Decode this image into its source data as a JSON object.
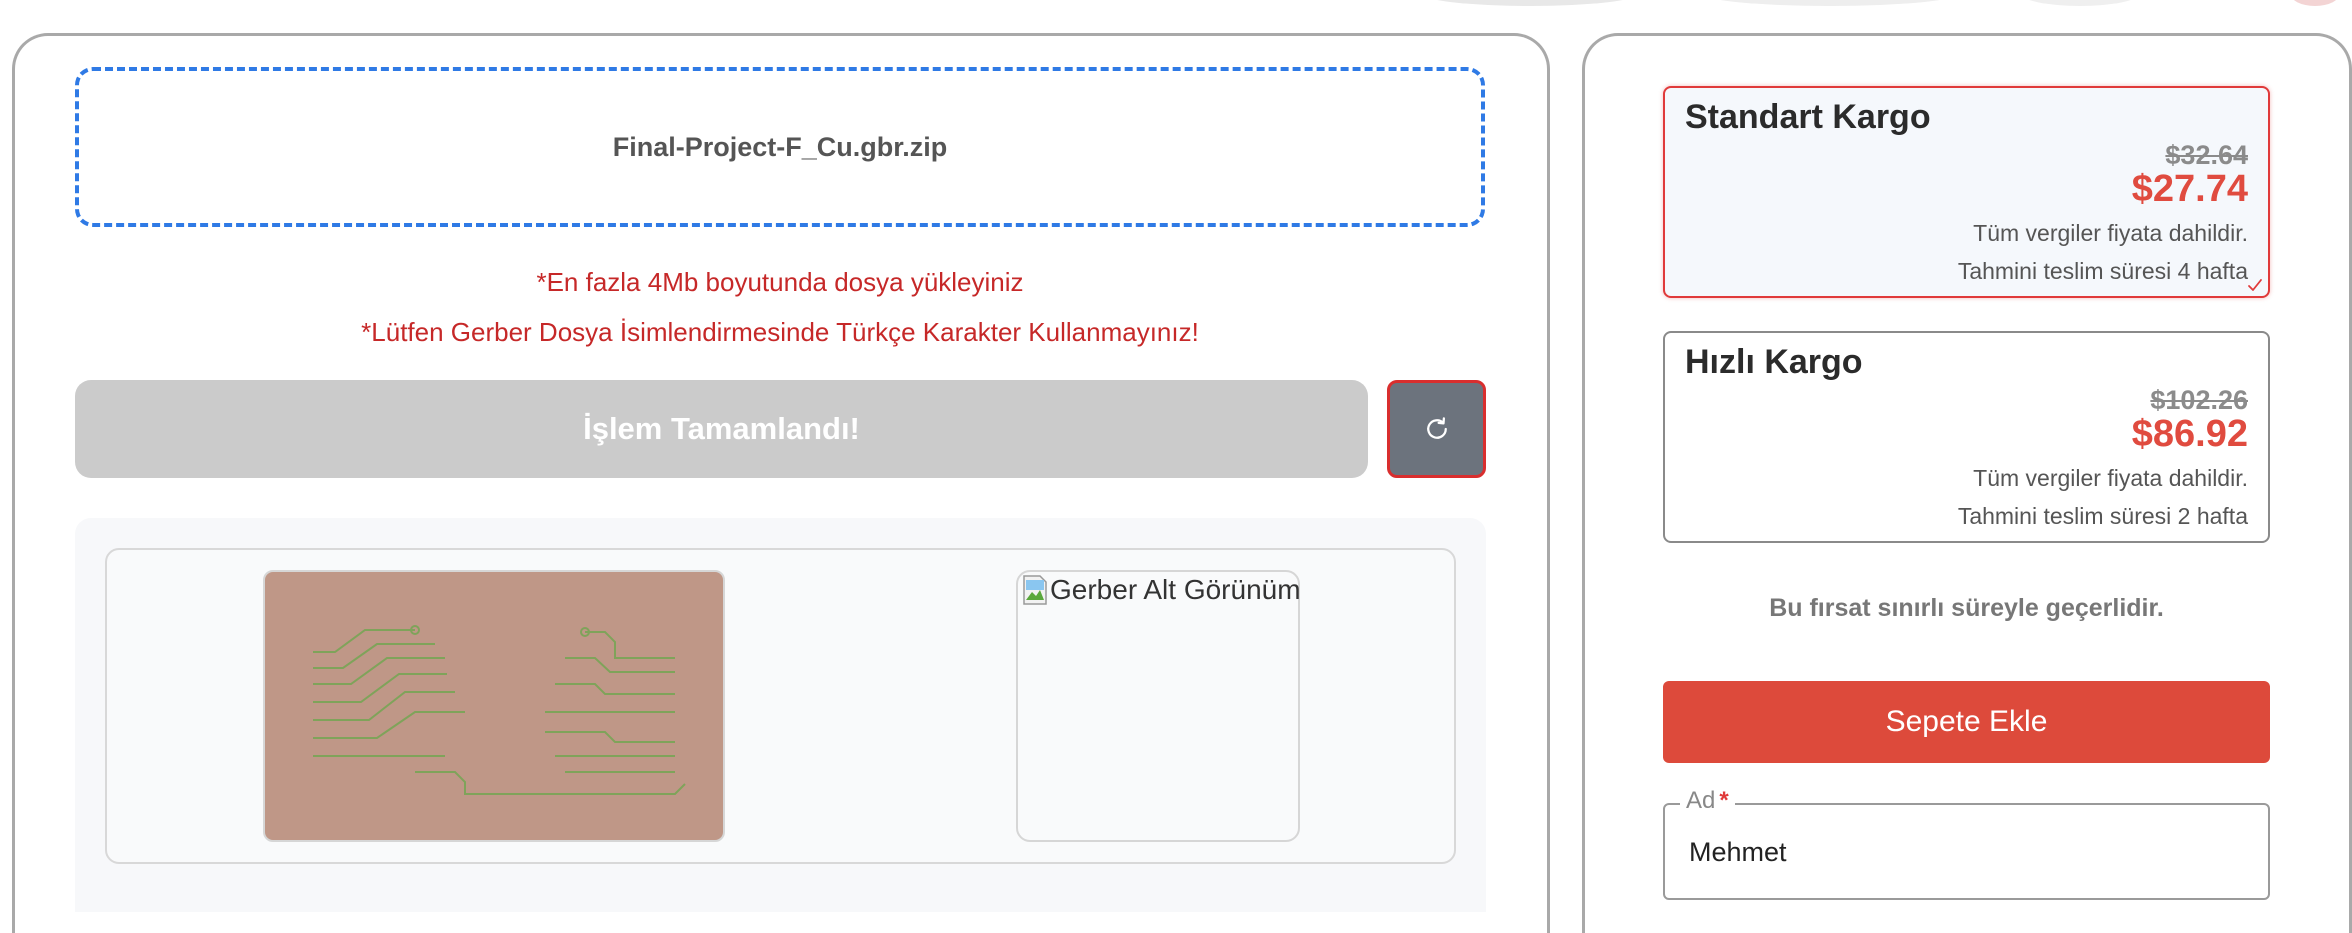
{
  "upload": {
    "file_name": "Final-Project-F_Cu.gbr.zip",
    "warning_size": "*En fazla 4Mb boyutunda dosya yükleyiniz",
    "warning_naming": "*Lütfen Gerber Dosya İsimlendirmesinde Türkçe Karakter Kullanmayınız!",
    "status_button": "İşlem Tamamlandı!",
    "refresh_icon": "refresh-icon"
  },
  "preview": {
    "top_view_icon": "pcb-trace-preview",
    "bottom_view_alt": "Gerber Alt Görünüm"
  },
  "shipping": {
    "options": [
      {
        "title": "Standart Kargo",
        "old_price": "$32.64",
        "price": "$27.74",
        "tax_note": "Tüm vergiler fiyata dahildir.",
        "delivery": "Tahmini teslim süresi 4 hafta",
        "selected": true
      },
      {
        "title": "Hızlı Kargo",
        "old_price": "$102.26",
        "price": "$86.92",
        "tax_note": "Tüm vergiler fiyata dahildir.",
        "delivery": "Tahmini teslim süresi 2 hafta",
        "selected": false
      }
    ],
    "offer_note": "Bu fırsat sınırlı süreyle geçerlidir.",
    "cart_button": "Sepete Ekle"
  },
  "form": {
    "name_label": "Ad",
    "required_mark": "*",
    "name_value": "Mehmet"
  },
  "colors": {
    "accent_red": "#dd4a3b",
    "price_red": "#e04b3f",
    "dropzone_blue": "#2f7ae5",
    "disabled_gray": "#cbcbcb"
  }
}
